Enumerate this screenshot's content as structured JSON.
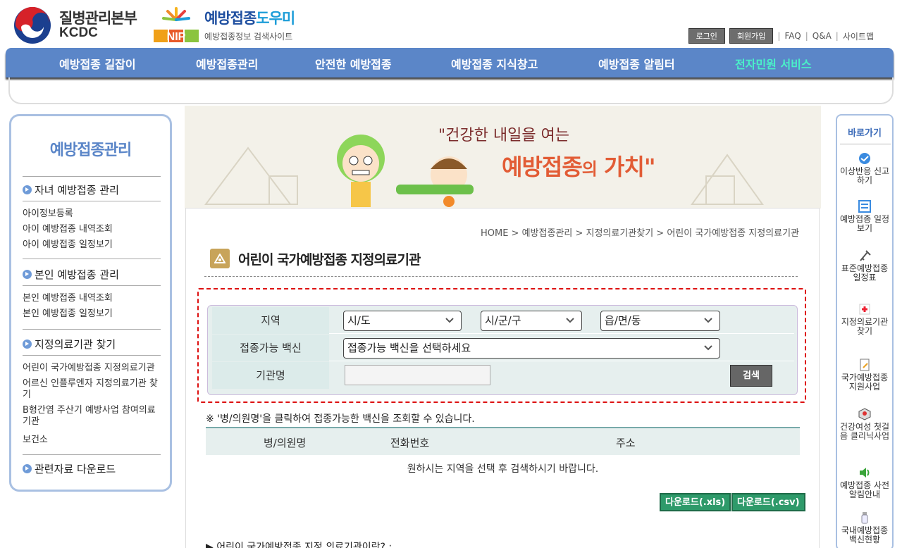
{
  "header": {
    "org_name": "질병관리본부",
    "org_abbr": "KCDC",
    "site_title_a": "예방접종",
    "site_title_b": "도우미",
    "site_sub": "예방접종정보 검색사이트",
    "nip_text": "NIP",
    "login": "로그인",
    "signup": "회원가입",
    "faq": "FAQ",
    "qna": "Q&A",
    "sitemap": "사이트맵"
  },
  "nav": {
    "items": [
      "예방접종 길잡이",
      "예방접종관리",
      "안전한 예방접종",
      "예방접종 지식창고",
      "예방접종 알림터",
      "전자민원 서비스"
    ]
  },
  "sidebar": {
    "title": "예방접종관리",
    "sections": [
      {
        "label": "자녀 예방접종 관리",
        "items": [
          "아이정보등록",
          "아이 예방접종 내역조회",
          "아이 예방접종 일정보기"
        ]
      },
      {
        "label": "본인 예방접종 관리",
        "items": [
          "본인 예방접종 내역조회",
          "본인 예방접종 일정보기"
        ]
      },
      {
        "label": "지정의료기관 찾기",
        "items": [
          "어린이 국가예방접종 지정의료기관",
          "어르신 인플루엔자 지정의료기관 찾기",
          "B형간염 주산기 예방사업 참여의료기관",
          "보건소"
        ]
      },
      {
        "label": "관련자료 다운로드",
        "items": []
      }
    ]
  },
  "quick": {
    "title": "바로가기",
    "items": [
      "이상반응 신고하기",
      "예방접종 일정보기",
      "표준예방접종 일정표",
      "지정의료기관 찾기",
      "국가예방접종 지원사업",
      "건강여성 첫걸음 클리닉사업",
      "예방접종 사전알림안내",
      "국내예방접종 백신현황"
    ]
  },
  "banner": {
    "slogan": "\"건강한 내일을 여는",
    "main_a": "예방접종",
    "main_b": "의",
    "main_c": "가치\""
  },
  "content": {
    "breadcrumb": "HOME > 예방접종관리 > 지정의료기관찾기 > 어린이 국가예방접종 지정의료기관",
    "page_title": "어린이 국가예방접종 지정의료기관",
    "search": {
      "region_label": "지역",
      "sido": "시/도",
      "sigungu": "시/군/구",
      "dong": "읍/면/동",
      "vaccine_label": "접종가능 백신",
      "vaccine_select": "접종가능 백신을 선택하세요",
      "name_label": "기관명",
      "name_value": "",
      "search_button": "검색"
    },
    "note": "※ '병/의원명'을 클릭하여 접종가능한 백신을 조회할 수 있습니다.",
    "table": {
      "columns": [
        "병/의원명",
        "전화번호",
        "주소"
      ],
      "empty": "원하시는 지역을 선택 후 검색하시기 바랍니다."
    },
    "download_xls": "다운로드(.xls)",
    "download_csv": "다운로드(.csv)",
    "footer_q": "▶ 어린이 국가예방접종 지정 의료기관이란? :"
  },
  "colors": {
    "nav_bg": "#5b86c8",
    "nav_highlight": "#4af0c8",
    "download_button": "#2e9a6a",
    "search_border": "#dd1111"
  }
}
